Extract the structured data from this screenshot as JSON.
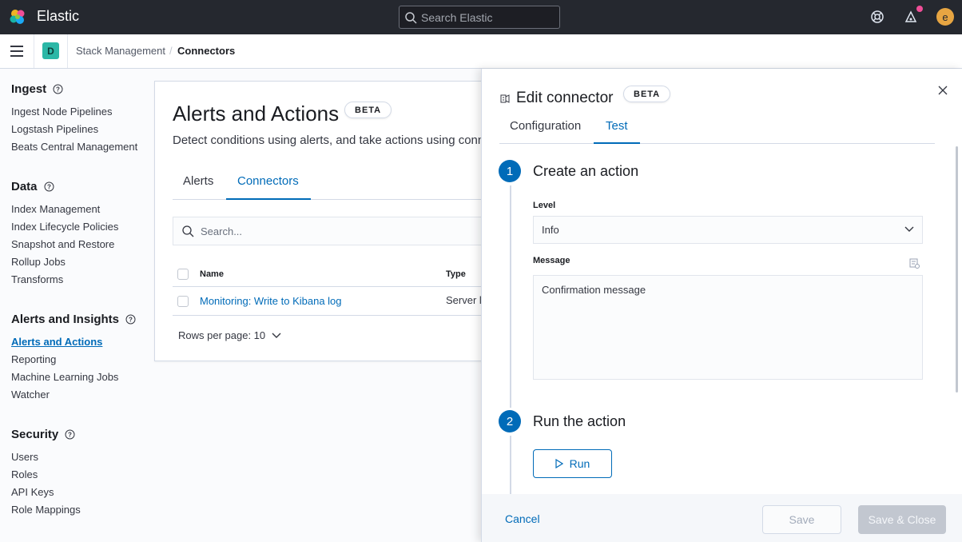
{
  "header": {
    "brand": "Elastic",
    "search_placeholder": "Search Elastic",
    "avatar_initial": "e",
    "colors": {
      "bg": "#25282f",
      "notification": "#f04e98",
      "avatar": "#e7a542"
    }
  },
  "breadcrumbs": {
    "space_initial": "D",
    "items": [
      "Stack Management",
      "Connectors"
    ],
    "separator": "/"
  },
  "sidenav": {
    "groups": [
      {
        "title": "Ingest",
        "items": [
          "Ingest Node Pipelines",
          "Logstash Pipelines",
          "Beats Central Management"
        ]
      },
      {
        "title": "Data",
        "items": [
          "Index Management",
          "Index Lifecycle Policies",
          "Snapshot and Restore",
          "Rollup Jobs",
          "Transforms"
        ]
      },
      {
        "title": "Alerts and Insights",
        "items": [
          "Alerts and Actions",
          "Reporting",
          "Machine Learning Jobs",
          "Watcher"
        ]
      },
      {
        "title": "Security",
        "items": [
          "Users",
          "Roles",
          "API Keys",
          "Role Mappings"
        ]
      }
    ],
    "active_item": "Alerts and Actions"
  },
  "main": {
    "title": "Alerts and Actions",
    "badge": "BETA",
    "description": "Detect conditions using alerts, and take actions using conn",
    "tabs": [
      "Alerts",
      "Connectors"
    ],
    "active_tab": "Connectors",
    "search_placeholder": "Search...",
    "table": {
      "columns": [
        "Name",
        "Type"
      ],
      "rows": [
        {
          "name": "Monitoring: Write to Kibana log",
          "type": "Server l"
        }
      ]
    },
    "rows_per_page": "Rows per page: 10"
  },
  "flyout": {
    "title": "Edit connector",
    "badge": "BETA",
    "tabs": [
      "Configuration",
      "Test"
    ],
    "active_tab": "Test",
    "steps": [
      {
        "number": "1",
        "title": "Create an action"
      },
      {
        "number": "2",
        "title": "Run the action"
      }
    ],
    "level_label": "Level",
    "level_value": "Info",
    "message_label": "Message",
    "message_value": "Confirmation message",
    "run_label": "Run",
    "footer": {
      "cancel": "Cancel",
      "save": "Save",
      "save_close": "Save & Close"
    }
  },
  "accent_color": "#006bb8"
}
